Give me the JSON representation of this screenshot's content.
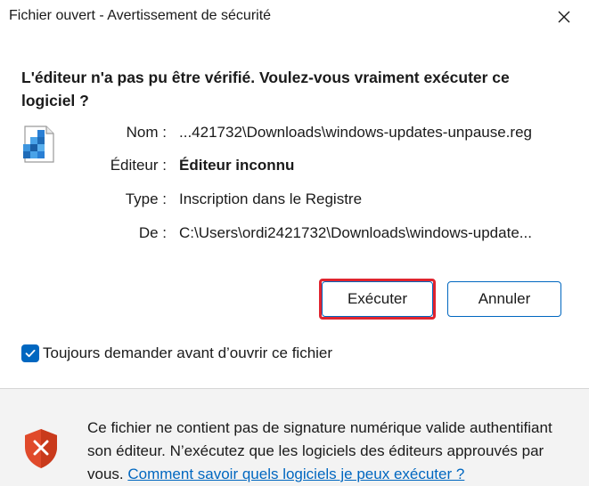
{
  "window": {
    "title": "Fichier ouvert - Avertissement de sécurité"
  },
  "heading": "L'éditeur n'a pas pu être vérifié. Voulez-vous vraiment exécuter ce logiciel ?",
  "file_icon": "registry-file-icon",
  "details": {
    "name_label": "Nom :",
    "name_value": "...421732\\Downloads\\windows-updates-unpause.reg",
    "publisher_label": "Éditeur :",
    "publisher_value": "Éditeur inconnu",
    "type_label": "Type :",
    "type_value": "Inscription dans le Registre",
    "from_label": "De :",
    "from_value": "C:\\Users\\ordi2421732\\Downloads\\windows-update..."
  },
  "buttons": {
    "run_label": "Exécuter",
    "cancel_label": "Annuler"
  },
  "checkbox": {
    "label": "Toujours demander avant d’ouvrir ce fichier",
    "checked": true
  },
  "footer": {
    "text": "Ce fichier ne contient pas de signature numérique valide authentifiant son éditeur. N’exécutez que les logiciels des éditeurs approuvés par vous. ",
    "link_text": "Comment savoir quels logiciels je peux exécuter ?"
  },
  "colors": {
    "accent": "#0067c0",
    "highlight": "#e0242f",
    "shield": "#e04a2b"
  }
}
